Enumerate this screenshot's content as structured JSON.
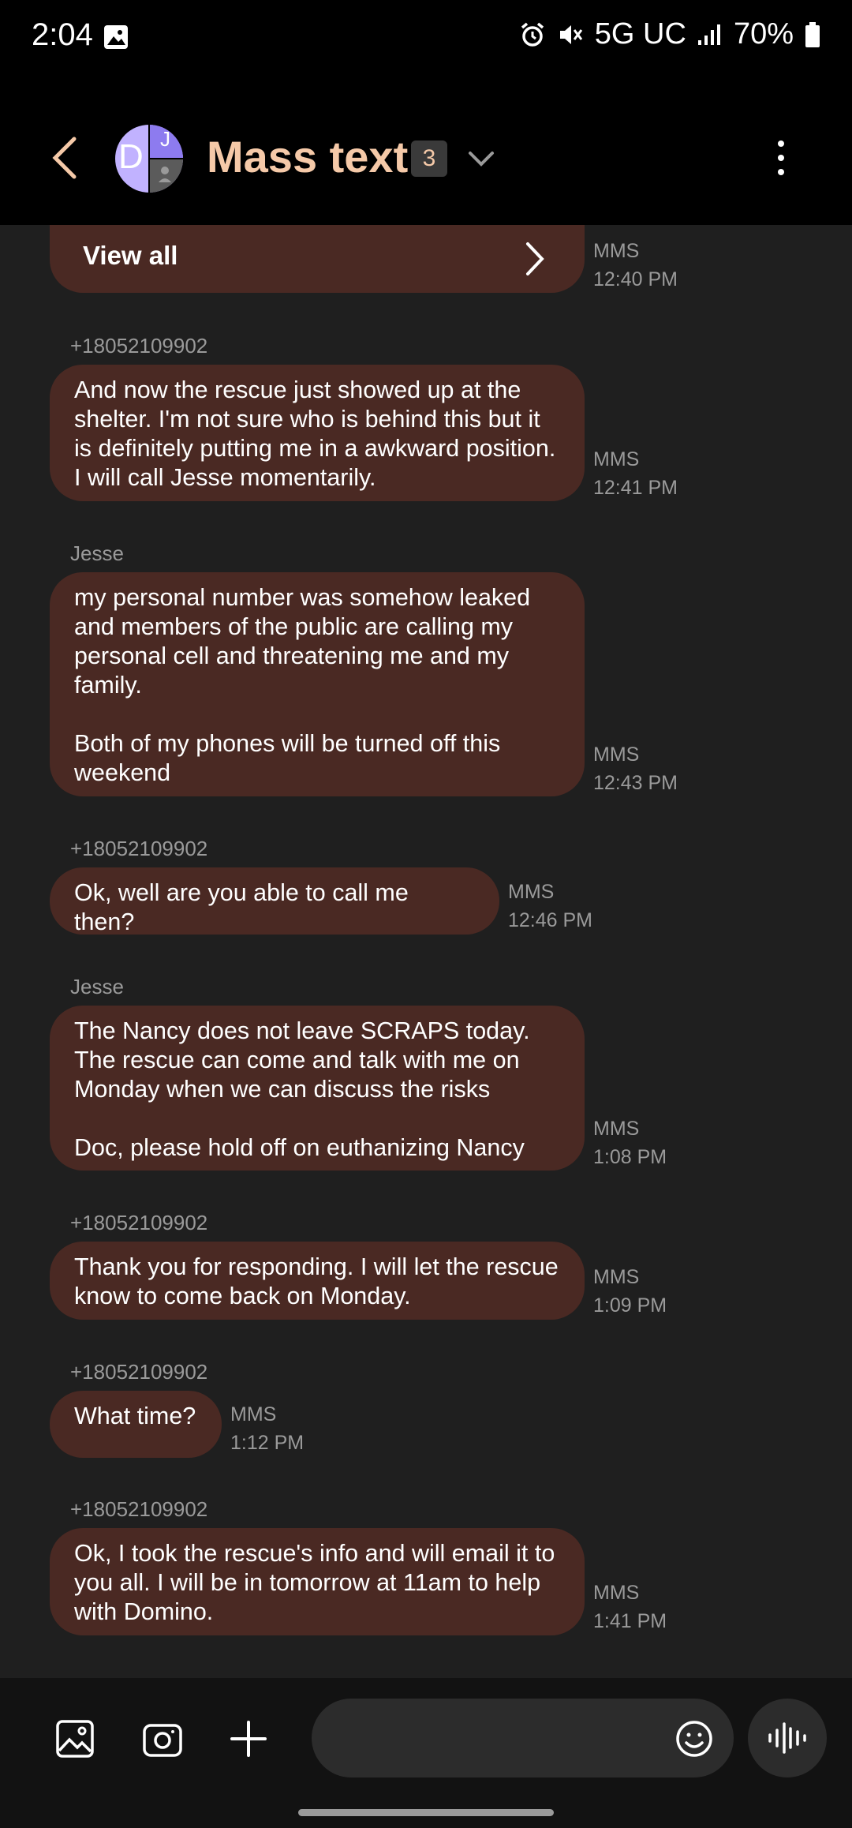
{
  "status_bar": {
    "time": "2:04",
    "network": "5G UC",
    "battery": "70%"
  },
  "header": {
    "title": "Mass text",
    "participant_count": "3",
    "avatar_letters": [
      "D",
      "J"
    ]
  },
  "view_all": {
    "label": "View all",
    "type": "MMS",
    "time": "12:40 PM"
  },
  "messages": [
    {
      "sender": "+18052109902",
      "text": "And now the rescue just showed up at the shelter. I'm not sure who is behind this but it is definitely putting me in a awkward position. I will call Jesse momentarily.",
      "type": "MMS",
      "time": "12:41 PM"
    },
    {
      "sender": "Jesse",
      "text": "my personal number was somehow leaked and members of the public are calling my personal cell and threatening me and my family.\n\nBoth of my phones will be turned off this weekend",
      "type": "MMS",
      "time": "12:43 PM"
    },
    {
      "sender": "+18052109902",
      "text": "Ok, well are you able to call me then?",
      "type": "MMS",
      "time": "12:46 PM"
    },
    {
      "sender": "Jesse",
      "text": "The Nancy does not leave SCRAPS today. The rescue can come and talk with me on Monday when we can discuss the risks\n\nDoc, please hold off on euthanizing Nancy",
      "type": "MMS",
      "time": "1:08 PM"
    },
    {
      "sender": "+18052109902",
      "text": "Thank you for responding. I will let the rescue know to come back on Monday.",
      "type": "MMS",
      "time": "1:09 PM"
    },
    {
      "sender": "+18052109902",
      "text": "What time?",
      "type": "MMS",
      "time": "1:12 PM"
    },
    {
      "sender": "+18052109902",
      "text": "Ok, I took the rescue's info and will email it to you all. I will be in tomorrow at 11am to help with Domino.",
      "type": "MMS",
      "time": "1:41 PM"
    }
  ],
  "composer": {
    "icons": [
      "gallery-icon",
      "camera-icon",
      "plus-icon",
      "emoji-icon",
      "voice-icon"
    ]
  }
}
